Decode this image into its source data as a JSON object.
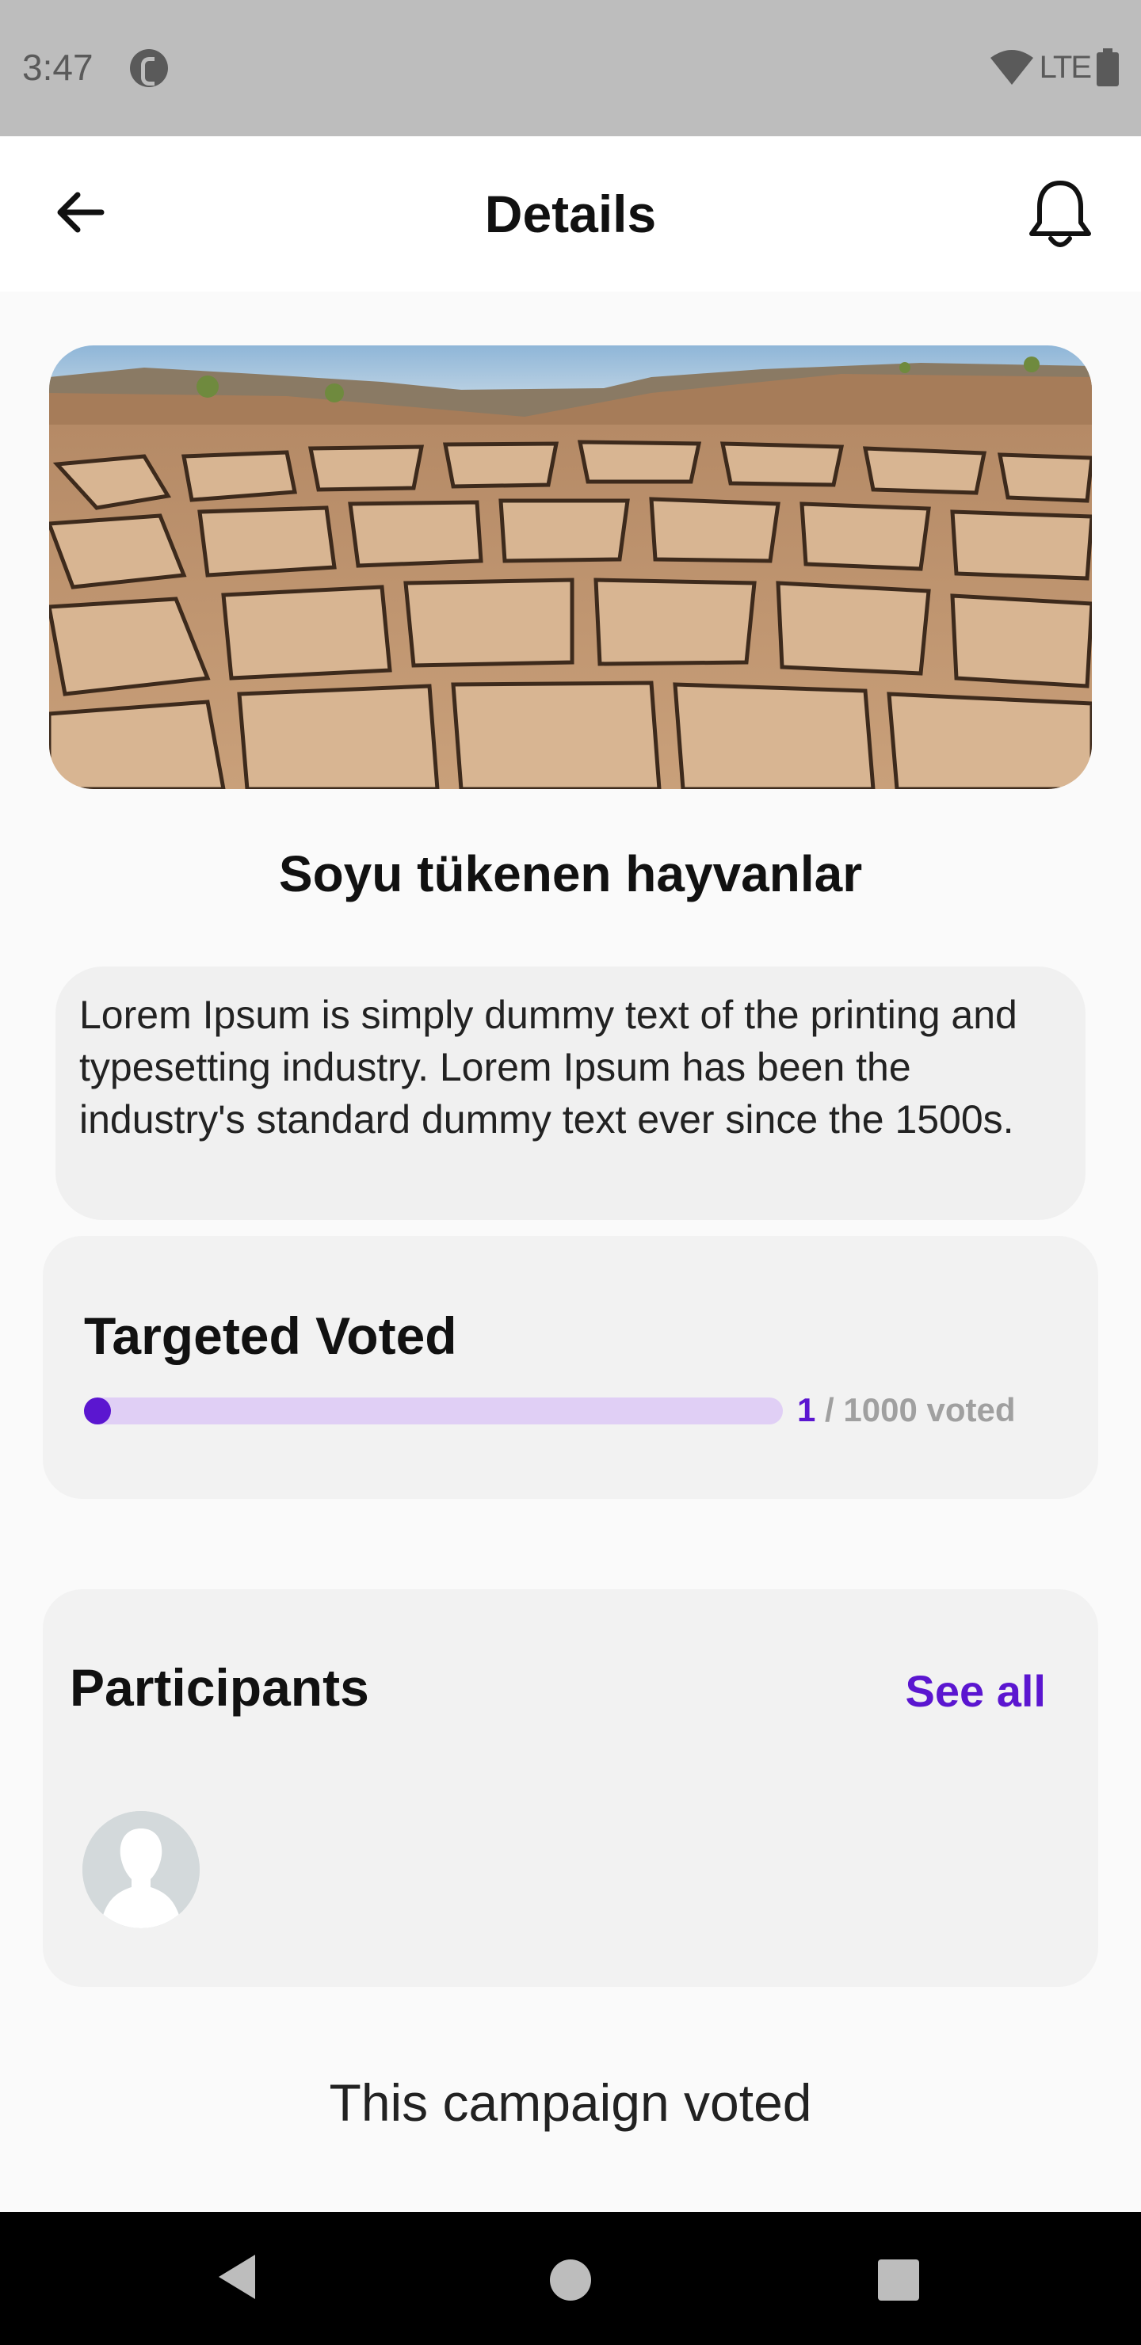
{
  "status_bar": {
    "time": "3:47",
    "network": "LTE",
    "icons": [
      "app-notification-icon",
      "wifi-icon",
      "battery-icon"
    ]
  },
  "app_bar": {
    "title": "Details",
    "back_icon": "arrow-left-icon",
    "notification_icon": "bell-icon"
  },
  "campaign": {
    "image": "cracked-dry-earth-photo",
    "title": "Soyu tükenen hayvanlar",
    "description": "Lorem Ipsum is simply dummy text of the printing and typesetting industry. Lorem Ipsum has been the industry's standard dummy text ever since the 1500s."
  },
  "votes": {
    "heading": "Targeted Voted",
    "current": "1",
    "separator": " / ",
    "target_label": "1000 voted",
    "progress_fraction": 0.001
  },
  "participants": {
    "heading": "Participants",
    "see_all_label": "See all",
    "avatars": [
      "default-avatar-icon"
    ]
  },
  "footer_message": "This campaign voted",
  "colors": {
    "accent": "#5b16d0",
    "progress_track": "#e0cff5",
    "card_background": "#f2f2f2",
    "status_bar": "#bdbdbd",
    "navigation_bar": "#000000"
  },
  "navigation": {
    "icons": [
      "nav-back-icon",
      "nav-home-icon",
      "nav-recents-icon"
    ]
  }
}
